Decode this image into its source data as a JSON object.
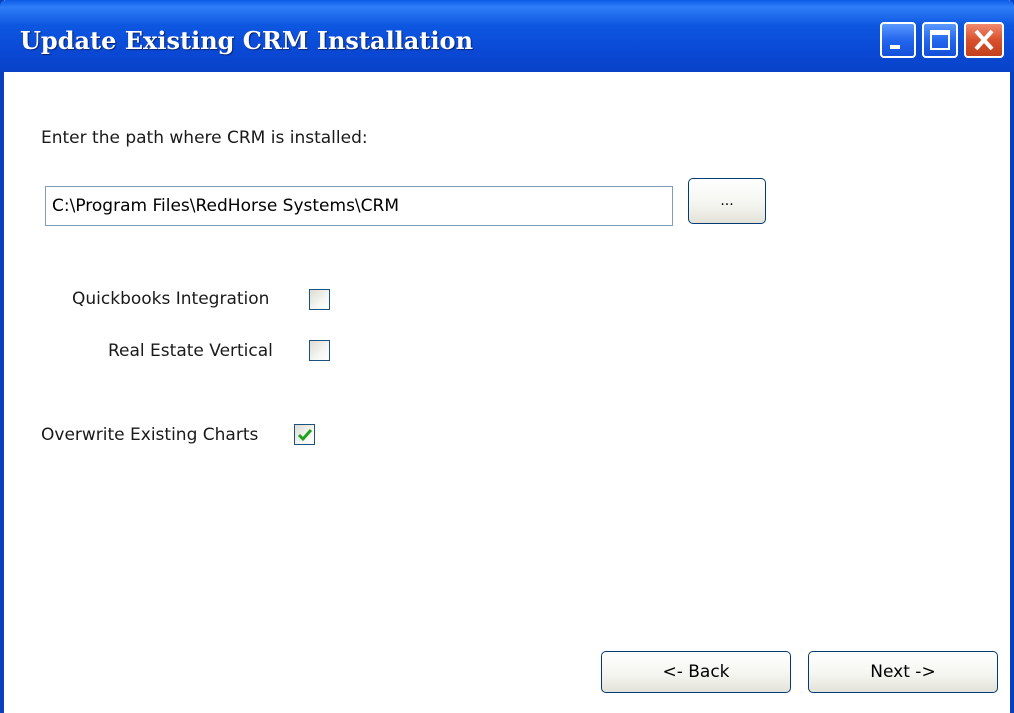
{
  "window": {
    "title": "Update Existing CRM Installation"
  },
  "path_section": {
    "prompt": "Enter the path where CRM is installed:",
    "path_value": "C:\\Program Files\\RedHorse Systems\\CRM",
    "browse_label": "..."
  },
  "options": [
    {
      "label": "Quickbooks Integration",
      "checked": false
    },
    {
      "label": "Real Estate Vertical",
      "checked": false
    },
    {
      "label": "Overwrite Existing Charts",
      "checked": true
    }
  ],
  "navigation": {
    "back_label": "<- Back",
    "next_label": "Next ->"
  },
  "colors": {
    "titlebar": "#0a49d6",
    "check_mark": "#21a121",
    "close_button": "#d8512d"
  }
}
